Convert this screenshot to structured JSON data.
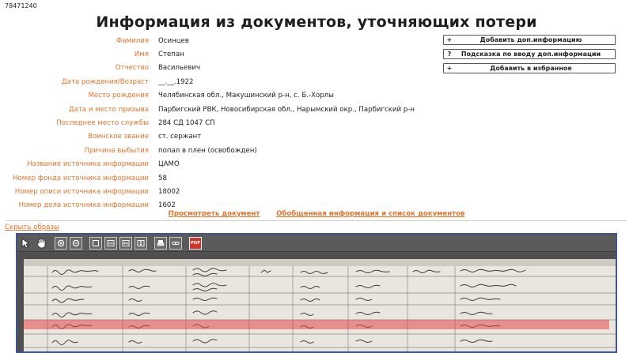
{
  "doc_id": "78471240",
  "title": "Информация из документов, уточняющих потери",
  "fields": [
    {
      "label": "Фамилия",
      "value": "Осинцев"
    },
    {
      "label": "Имя",
      "value": "Степан"
    },
    {
      "label": "Отчество",
      "value": "Васильевич"
    },
    {
      "label": "Дата рождения/Возраст",
      "value": "__.__.1922"
    },
    {
      "label": "Место рождения",
      "value": "Челябинская обл., Макушинский р-н, с. Б.-Хорлы"
    },
    {
      "label": "Дата и место призыва",
      "value": "Парбигский РВК, Новосибирская обл., Нарымский окр., Парбигский р-н"
    },
    {
      "label": "Последнее место службы",
      "value": "284 СД 1047 СП"
    },
    {
      "label": "Воинское звание",
      "value": "ст. сержант"
    },
    {
      "label": "Причина выбытия",
      "value": "попал в плен (освобожден)"
    },
    {
      "label": "Название источника информации",
      "value": "ЦАМО"
    },
    {
      "label": "Номер фонда источника информации",
      "value": "58"
    },
    {
      "label": "Номер описи источника информации",
      "value": "18002"
    },
    {
      "label": "Номер дела источника информации",
      "value": "1602"
    }
  ],
  "side_buttons": [
    {
      "symbol": "+",
      "label": "Добавить доп.информацию"
    },
    {
      "symbol": "?",
      "label": "Подсказка по вводу доп.информации"
    },
    {
      "symbol": "+",
      "label": "Добавить в избранное"
    }
  ],
  "links": {
    "view_document": "Просмотреть документ",
    "summary": "Обобщенная информация и список документов"
  },
  "hide_images": "Скрыть образы",
  "toolbar": {
    "icons": [
      "select-arrow-icon",
      "pan-hand-icon",
      "zoom-in-icon",
      "zoom-out-icon",
      "fit-page-icon",
      "actual-size-icon",
      "fit-width-icon",
      "fit-height-icon",
      "print-icon",
      "link-icon",
      "pdf-icon"
    ],
    "pdf_label": "PDF"
  },
  "colors": {
    "label": "#e8742a",
    "viewer_border": "#41548c",
    "highlight": "#e84646"
  }
}
